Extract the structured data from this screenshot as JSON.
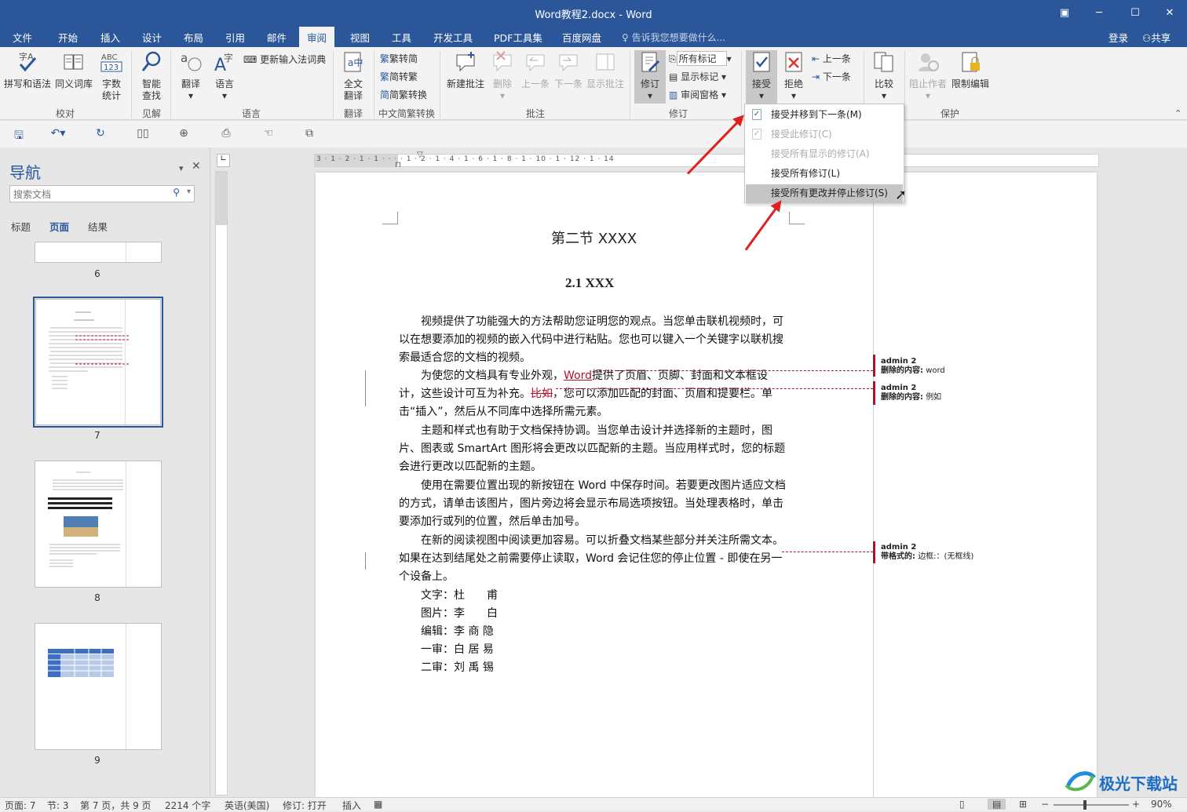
{
  "window": {
    "title": "Word教程2.docx - Word"
  },
  "tabs": [
    "文件",
    "开始",
    "插入",
    "设计",
    "布局",
    "引用",
    "邮件",
    "审阅",
    "视图",
    "工具",
    "开发工具",
    "PDF工具集",
    "百度网盘"
  ],
  "tellme": "告诉我您想要做什么...",
  "signin": "登录",
  "share": "共享",
  "ribbon": {
    "spelling": "拼写和语法",
    "thesaurus": "同义词库",
    "wordcount1": "字数",
    "wordcount2": "统计",
    "group_proof": "校对",
    "smart1": "智能",
    "smart2": "查找",
    "group_insight": "见解",
    "translate": "翻译",
    "language": "语言",
    "ime": "更新输入法词典",
    "group_language": "语言",
    "fulltrans1": "全文",
    "fulltrans2": "翻译",
    "group_translate": "翻译",
    "t2s": "繁转简",
    "s2t": "简转繁",
    "conv": "简繁转换",
    "group_chinese": "中文简繁转换",
    "newcomment": "新建批注",
    "delete": "删除",
    "prev": "上一条",
    "next": "下一条",
    "showcomments": "显示批注",
    "group_comments": "批注",
    "track": "修订",
    "allmarkup": "所有标记",
    "showmarkup": "显示标记",
    "pane": "审阅窗格",
    "group_tracking": "修订",
    "accept": "接受",
    "reject": "拒绝",
    "prevchange": "上一条",
    "nextchange": "下一条",
    "compare": "比较",
    "block": "阻止作者",
    "restrict": "限制编辑",
    "group_protect": "保护"
  },
  "dropdown": [
    {
      "label": "接受并移到下一条(M)",
      "disabled": false
    },
    {
      "label": "接受此修订(C)",
      "disabled": true
    },
    {
      "label": "接受所有显示的修订(A)",
      "disabled": true
    },
    {
      "label": "接受所有修订(L)",
      "disabled": false
    },
    {
      "label": "接受所有更改并停止修订(S)",
      "disabled": false
    }
  ],
  "nav": {
    "title": "导航",
    "search_placeholder": "搜索文档",
    "tabs": [
      "标题",
      "页面",
      "结果"
    ],
    "pages": [
      "6",
      "7",
      "8",
      "9"
    ]
  },
  "ruler": {
    "h": "3 · 1 · 2 · 1 · 1 · · · · 1 · 2 · 1 · 4 · 1 · 6 · 1 · 8 · 1 · 10 · 1 · 12 · 1 · 14"
  },
  "doc": {
    "heading1": "第二节 XXXX",
    "heading2": "2.1 XXX",
    "p1": "视频提供了功能强大的方法帮助您证明您的观点。当您单击联机视频时，可以在想要添加的视频的嵌入代码中进行粘贴。您也可以键入一个关键字以联机搜索最适合您的文档的视频。",
    "p2a": "为使您的文档具有专业外观，",
    "p2del1": "Word",
    "p2b": "提供了页眉、页脚、封面和文本框设计，这些设计可互为补充。",
    "p2del2": "比如",
    "p2c": "，您可以添加匹配的封面、页眉和提要栏。单击“插入”，然后从不同库中选择所需元素。",
    "p3": "主题和样式也有助于文档保持协调。当您单击设计并选择新的主题时，图片、图表或 SmartArt 图形将会更改以匹配新的主题。当应用样式时，您的标题会进行更改以匹配新的主题。",
    "p4": "使用在需要位置出现的新按钮在 Word 中保存时间。若要更改图片适应文档的方式，请单击该图片，图片旁边将会显示布局选项按钮。当处理表格时，单击要添加行或列的位置，然后单击加号。",
    "p5": "在新的阅读视图中阅读更加容易。可以折叠文档某些部分并关注所需文本。如果在达到结尾处之前需要停止读取，Word 会记住您的停止位置 - 即使在另一个设备上。",
    "credits": [
      {
        "k": "文字：",
        "v": "杜　　甫"
      },
      {
        "k": "图片：",
        "v": "李　　白"
      },
      {
        "k": "编辑：",
        "v": "李 商 隐"
      },
      {
        "k": "一审：",
        "v": "白 居 易"
      },
      {
        "k": "二审：",
        "v": "刘 禹 锡"
      }
    ]
  },
  "balloons": [
    {
      "author": "admin 2",
      "label": "删除的内容:",
      "value": "word"
    },
    {
      "author": "admin 2",
      "label": "删除的内容:",
      "value": "例如"
    },
    {
      "author": "admin 2",
      "label": "带格式的:",
      "value": "边框:：(无框线)"
    }
  ],
  "status": {
    "page": "页面: 7",
    "section": "节: 3",
    "pageof": "第 7 页，共 9 页",
    "words": "2214 个字",
    "lang": "英语(美国)",
    "track": "修订: 打开",
    "mode": "插入",
    "zoom": "90%"
  },
  "watermark": "极光下载站",
  "colors": {
    "accent": "#2b579a",
    "revision": "#b0112c",
    "arrow": "#e02020"
  }
}
